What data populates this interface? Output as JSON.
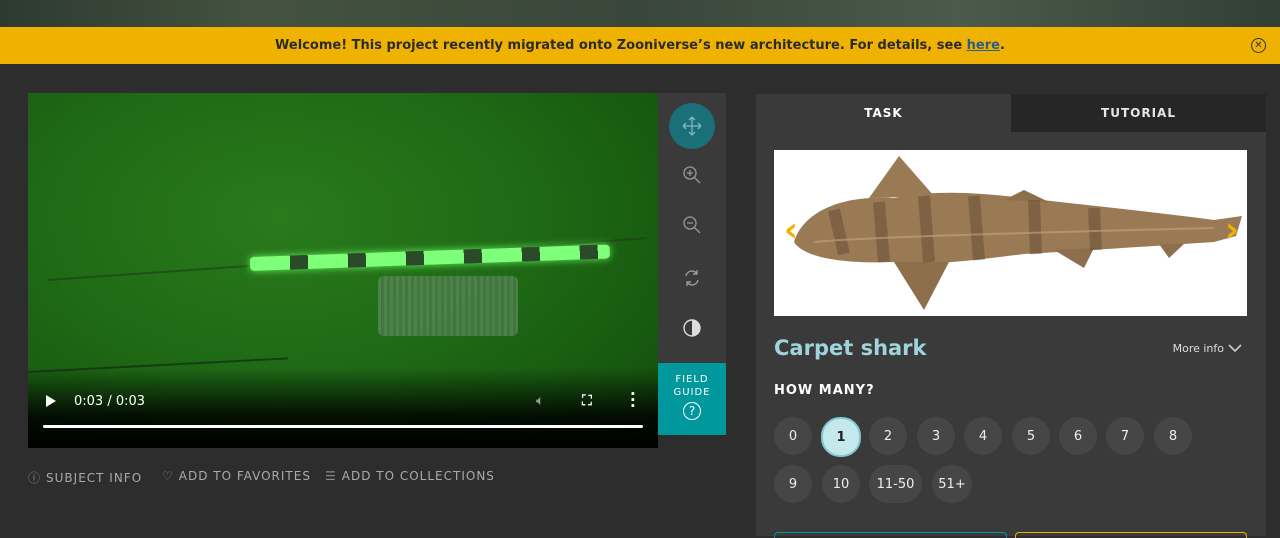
{
  "banner": {
    "text": "Welcome! This project recently migrated onto Zooniverse’s new architecture. For details, see ",
    "link": "here",
    "end": "."
  },
  "video": {
    "time": "0:03 / 0:03"
  },
  "field_guide": {
    "line1": "FIELD",
    "line2": "GUIDE",
    "icon": "?"
  },
  "meta": {
    "subject_info": "SUBJECT INFO",
    "favorites": "ADD TO FAVORITES",
    "collections": "ADD TO COLLECTIONS"
  },
  "tabs": {
    "task": "TASK",
    "tutorial": "TUTORIAL"
  },
  "species": {
    "name": "Carpet shark",
    "more_info": "More info"
  },
  "how_many": {
    "label": "HOW MANY?",
    "options": [
      "0",
      "1",
      "2",
      "3",
      "4",
      "5",
      "6",
      "7",
      "8",
      "9",
      "10",
      "11-50",
      "51+"
    ],
    "selected": "1"
  },
  "colors": {
    "banner": "#f0b200",
    "accent": "#00979d",
    "species": "#9fd4dc"
  }
}
